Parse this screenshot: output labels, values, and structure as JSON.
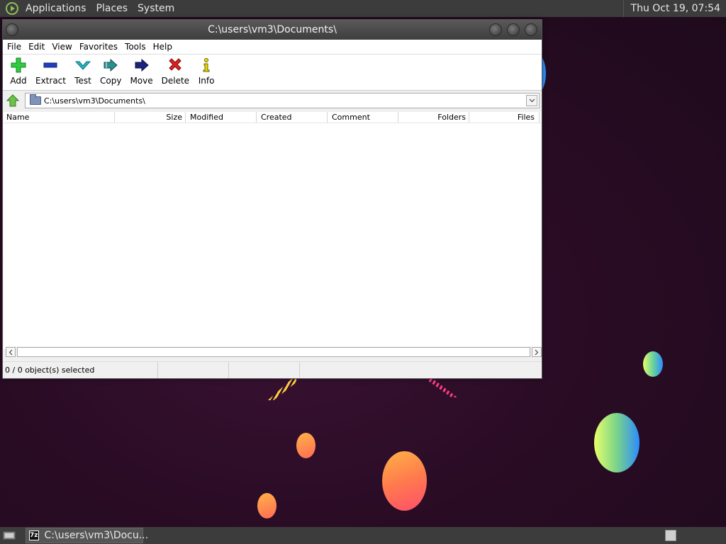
{
  "top_panel": {
    "menus": [
      "Applications",
      "Places",
      "System"
    ],
    "clock": "Thu Oct 19, 07:54"
  },
  "window": {
    "title": "C:\\users\\vm3\\Documents\\",
    "menubar": [
      "File",
      "Edit",
      "View",
      "Favorites",
      "Tools",
      "Help"
    ],
    "toolbar": [
      {
        "label": "Add",
        "icon": "add-icon",
        "color": "#2ecc40"
      },
      {
        "label": "Extract",
        "icon": "extract-icon",
        "color": "#1f3fbf"
      },
      {
        "label": "Test",
        "icon": "test-icon",
        "color": "#1fb8c9"
      },
      {
        "label": "Copy",
        "icon": "copy-icon",
        "color": "#2a8f8f"
      },
      {
        "label": "Move",
        "icon": "move-icon",
        "color": "#1a237e"
      },
      {
        "label": "Delete",
        "icon": "delete-icon",
        "color": "#e02020"
      },
      {
        "label": "Info",
        "icon": "info-icon",
        "color": "#a89d00"
      }
    ],
    "address": "C:\\users\\vm3\\Documents\\",
    "columns": [
      "Name",
      "Size",
      "Modified",
      "Created",
      "Comment",
      "Folders",
      "Files"
    ],
    "status": {
      "selection": "0 / 0 object(s) selected",
      "cell2": "",
      "cell3": "",
      "cell4": ""
    }
  },
  "taskbar": {
    "task_label": "C:\\users\\vm3\\Docu...",
    "task_icon_text": "7z"
  }
}
